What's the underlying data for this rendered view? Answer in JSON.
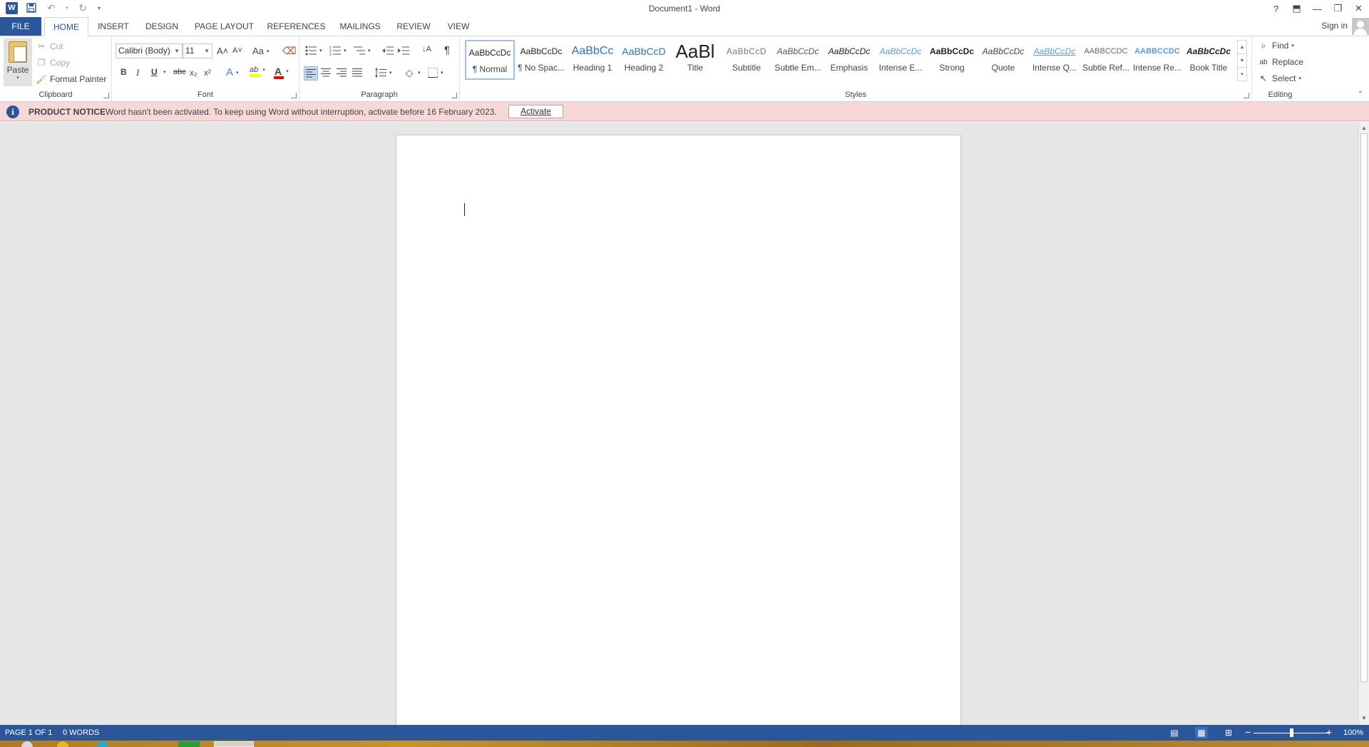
{
  "titlebar": {
    "title": "Document1 - Word",
    "help": "?",
    "ribbon_display": "⬒",
    "minimize": "—",
    "restore": "❐",
    "close": "✕"
  },
  "tabs": {
    "file": "FILE",
    "items": [
      "HOME",
      "INSERT",
      "DESIGN",
      "PAGE LAYOUT",
      "REFERENCES",
      "MAILINGS",
      "REVIEW",
      "VIEW"
    ],
    "active": "HOME",
    "sign_in": "Sign in"
  },
  "clipboard": {
    "label": "Clipboard",
    "paste": "Paste",
    "cut": "Cut",
    "copy": "Copy",
    "format_painter": "Format Painter"
  },
  "font": {
    "label": "Font",
    "family": "Calibri (Body)",
    "size": "11",
    "grow": "A˄",
    "shrink": "A˅",
    "change_case": "Aa",
    "bold": "B",
    "italic": "I",
    "underline": "U",
    "strike": "abc",
    "subscript": "x₂",
    "superscript": "x²",
    "text_effects": "A",
    "highlight": "ab",
    "font_color": "A",
    "highlight_color": "#ffff00",
    "font_color_value": "#ff0000"
  },
  "paragraph": {
    "label": "Paragraph",
    "show_marks": "¶",
    "sort": "↓A"
  },
  "styles": {
    "label": "Styles",
    "items": [
      {
        "preview": "AaBbCcDc",
        "name": "¶ Normal"
      },
      {
        "preview": "AaBbCcDc",
        "name": "¶ No Spac..."
      },
      {
        "preview": "AaBbCc",
        "name": "Heading 1"
      },
      {
        "preview": "AaBbCcD",
        "name": "Heading 2"
      },
      {
        "preview": "AaBl",
        "name": "Title"
      },
      {
        "preview": "AaBbCcD",
        "name": "Subtitle"
      },
      {
        "preview": "AaBbCcDc",
        "name": "Subtle Em..."
      },
      {
        "preview": "AaBbCcDc",
        "name": "Emphasis"
      },
      {
        "preview": "AaBbCcDc",
        "name": "Intense E..."
      },
      {
        "preview": "AaBbCcDc",
        "name": "Strong"
      },
      {
        "preview": "AaBbCcDc",
        "name": "Quote"
      },
      {
        "preview": "AaBbCcDc",
        "name": "Intense Q..."
      },
      {
        "preview": "AABBCCDC",
        "name": "Subtle Ref..."
      },
      {
        "preview": "AABBCCDC",
        "name": "Intense Re..."
      },
      {
        "preview": "AaBbCcDc",
        "name": "Book Title"
      }
    ]
  },
  "editing": {
    "label": "Editing",
    "find": "Find",
    "replace": "Replace",
    "select": "Select"
  },
  "notice": {
    "title": "PRODUCT NOTICE",
    "message": "Word hasn't been activated. To keep using Word without interruption, activate before 16 February 2023.",
    "button": "Activate",
    "icon": "i"
  },
  "status": {
    "page": "PAGE 1 OF 1",
    "words": "0 WORDS",
    "zoom": "100%",
    "zoom_minus": "−",
    "zoom_plus": "+",
    "zoom_fraction": 0.5
  },
  "colors": {
    "accent": "#2b579a",
    "notice_bg": "#f8d7d8"
  }
}
